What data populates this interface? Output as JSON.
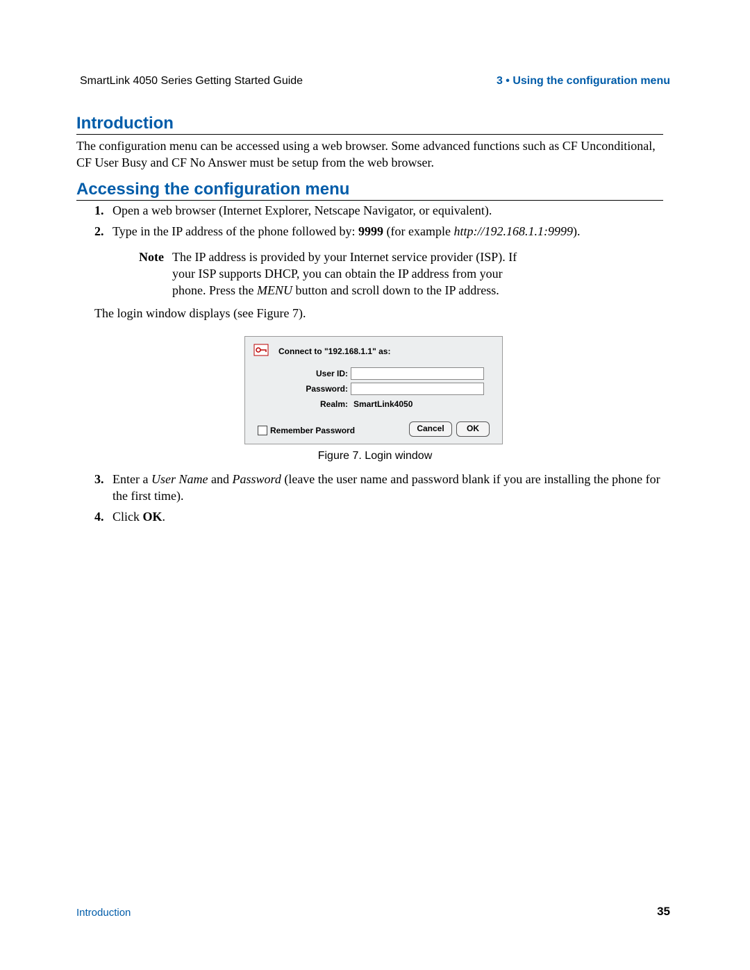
{
  "header": {
    "left": "SmartLink 4050 Series Getting Started Guide",
    "right": "3 • Using the configuration menu"
  },
  "section1": {
    "title": "Introduction",
    "body": "The configuration menu can be accessed using a web browser. Some advanced functions such as CF Unconditional, CF User Busy and CF No Answer must be setup from the web browser."
  },
  "section2": {
    "title": "Accessing the configuration menu",
    "steps": {
      "n1": "1.",
      "t1": "Open a web browser (Internet Explorer, Netscape Navigator, or equivalent).",
      "n2": "2.",
      "t2a": "Type in the IP address of the phone followed by: ",
      "t2b": "9999",
      "t2c": " (for example ",
      "t2d": "http://192.168.1.1:9999",
      "t2e": ")."
    },
    "note_label": "Note",
    "note_text_a": "The IP address is provided by your Internet service provider (ISP). If your ISP supports DHCP, you can obtain the IP address from your phone. Press the ",
    "note_text_b": "MENU",
    "note_text_c": " button and scroll down to the IP address.",
    "login_line": "The login window displays (see Figure 7).",
    "steps2": {
      "n3": "3.",
      "t3a": "Enter a ",
      "t3b": "User Name",
      "t3c": " and ",
      "t3d": "Password",
      "t3e": " (leave the user name and password blank if you are installing the phone for the first time).",
      "n4": "4.",
      "t4a": "Click ",
      "t4b": "OK",
      "t4c": "."
    }
  },
  "login": {
    "connect": "Connect to \"192.168.1.1\" as:",
    "userid_label": "User ID:",
    "password_label": "Password:",
    "realm_label": "Realm:",
    "realm_value": "SmartLink4050",
    "remember": "Remember Password",
    "cancel": "Cancel",
    "ok": "OK"
  },
  "figure_caption": "Figure 7. Login window",
  "footer": {
    "left": "Introduction",
    "page": "35"
  }
}
